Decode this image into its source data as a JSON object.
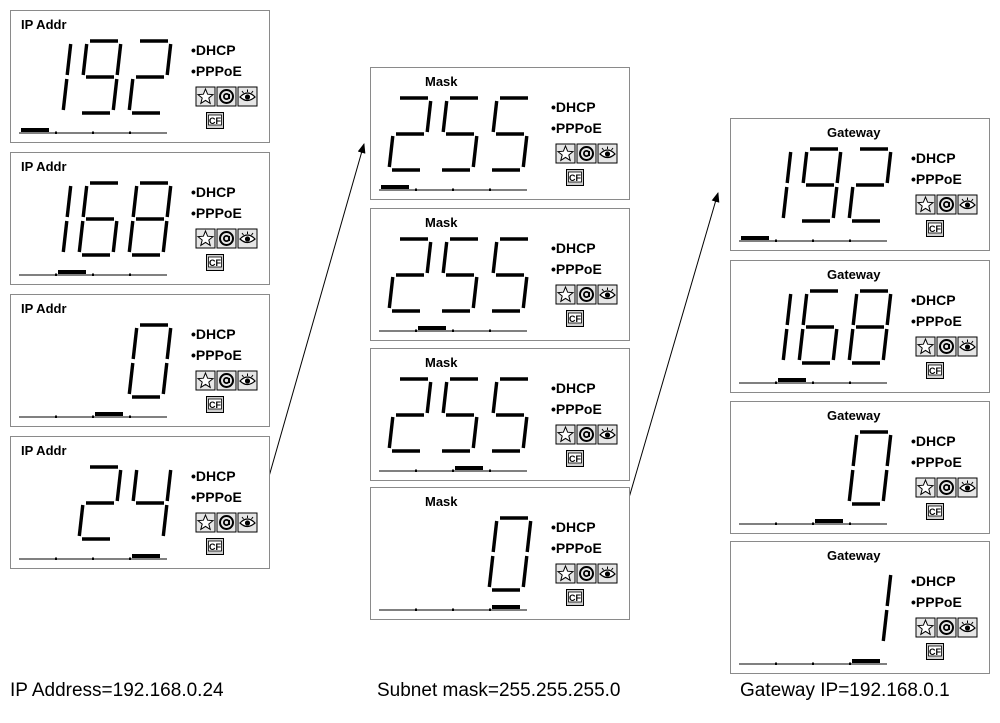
{
  "columns": [
    {
      "caption": "IP Address=192.168.0.24",
      "panels": [
        {
          "title": "IP Addr",
          "value": "192",
          "active_octet": 0
        },
        {
          "title": "IP Addr",
          "value": "168",
          "active_octet": 1
        },
        {
          "title": "IP Addr",
          "value": "0",
          "active_octet": 2
        },
        {
          "title": "IP Addr",
          "value": "24",
          "active_octet": 3
        }
      ]
    },
    {
      "caption": "Subnet mask=255.255.255.0",
      "panels": [
        {
          "title": "Mask",
          "value": "255",
          "active_octet": 0
        },
        {
          "title": "Mask",
          "value": "255",
          "active_octet": 1
        },
        {
          "title": "Mask",
          "value": "255",
          "active_octet": 2
        },
        {
          "title": "Mask",
          "value": "0",
          "active_octet": 3
        }
      ]
    },
    {
      "caption": "Gateway IP=192.168.0.1",
      "panels": [
        {
          "title": "Gateway",
          "value": "192",
          "active_octet": 0
        },
        {
          "title": "Gateway",
          "value": "168",
          "active_octet": 1
        },
        {
          "title": "Gateway",
          "value": "0",
          "active_octet": 2
        },
        {
          "title": "Gateway",
          "value": "1",
          "active_octet": 3
        }
      ]
    }
  ],
  "options": {
    "dhcp": "•DHCP",
    "pppoe": "•PPPoE"
  },
  "icons": [
    "star-shield-icon",
    "at-sign-icon",
    "eye-icon",
    "cf-card-icon"
  ]
}
